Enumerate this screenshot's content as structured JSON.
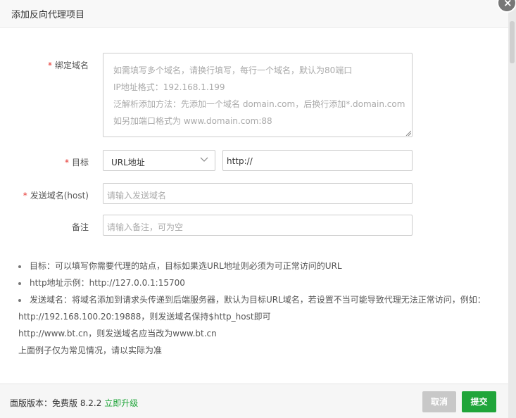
{
  "dialog": {
    "title": "添加反向代理项目"
  },
  "form": {
    "domain": {
      "label": "绑定域名",
      "required_mark": "*",
      "placeholder_lines": [
        "如需填写多个域名，请换行填写，每行一个域名，默认为80端口",
        "IP地址格式：192.168.1.199",
        "泛解析添加方法：先添加一个域名 domain.com，后换行添加*.domain.com",
        "如另加端口格式为 www.domain.com:88"
      ]
    },
    "target": {
      "label": "目标",
      "required_mark": "*",
      "select_value": "URL地址",
      "url_value": "http://"
    },
    "host": {
      "label": "发送域名(host)",
      "required_mark": "*",
      "placeholder": "请输入发送域名"
    },
    "remark": {
      "label": "备注",
      "placeholder": "请输入备注，可为空"
    }
  },
  "tips": [
    "目标：可以填写你需要代理的站点，目标如果选URL地址则必须为可正常访问的URL",
    "http地址示例：http://127.0.0.1:15700",
    "发送域名：将域名添加到请求头传递到后端服务器，默认为目标URL域名，若设置不当可能导致代理无法正常访问，例如：",
    "http://192.168.100.20:19888，则发送域名保持$http_host即可",
    "http://www.bt.cn，则发送域名应当改为www.bt.cn",
    "上面例子仅为常见情况，请以实际为准"
  ],
  "footer": {
    "version_text": "面版版本：免费版 8.2.2",
    "upgrade_link": "立即升级",
    "cancel_label": "取消",
    "submit_label": "提交"
  },
  "colors": {
    "accent_green": "#20a53a",
    "required_red": "#e5322d",
    "cancel_gray": "#c8c8c8"
  },
  "icons": {
    "close": "close-icon",
    "dropdown": "chevron-down-icon",
    "resize": "resize-handle-icon"
  }
}
